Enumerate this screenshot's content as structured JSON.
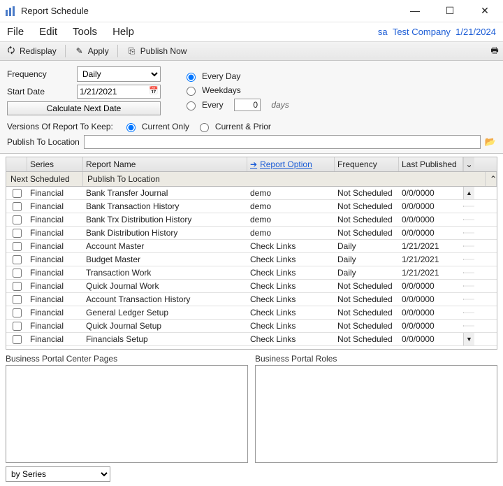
{
  "window": {
    "title": "Report Schedule"
  },
  "menu": {
    "file": "File",
    "edit": "Edit",
    "tools": "Tools",
    "help": "Help",
    "user": "sa",
    "company": "Test Company",
    "date": "1/21/2024"
  },
  "toolbar": {
    "redisplay": "Redisplay",
    "apply": "Apply",
    "publish_now": "Publish Now"
  },
  "form": {
    "frequency_label": "Frequency",
    "frequency_value": "Daily",
    "start_label": "Start Date",
    "start_value": "1/21/2021",
    "calc_button": "Calculate Next Date",
    "every_day": "Every Day",
    "weekdays": "Weekdays",
    "every": "Every",
    "every_n": "0",
    "every_unit": "days"
  },
  "versions": {
    "label": "Versions Of Report To Keep:",
    "current_only": "Current Only",
    "current_prior": "Current & Prior"
  },
  "publish": {
    "label": "Publish To Location",
    "value": ""
  },
  "grid": {
    "hdr": {
      "series": "Series",
      "report_name": "Report Name",
      "report_option": "Report Option",
      "frequency": "Frequency",
      "last_published": "Last Published"
    },
    "sub": {
      "next_scheduled": "Next Scheduled",
      "publish_to": "Publish To Location"
    },
    "rows": [
      {
        "series": "Financial",
        "name": "Bank Transfer Journal",
        "opt": "demo",
        "freq": "Not Scheduled",
        "last": "0/0/0000"
      },
      {
        "series": "Financial",
        "name": "Bank Transaction History",
        "opt": "demo",
        "freq": "Not Scheduled",
        "last": "0/0/0000"
      },
      {
        "series": "Financial",
        "name": "Bank Trx Distribution History",
        "opt": "demo",
        "freq": "Not Scheduled",
        "last": "0/0/0000"
      },
      {
        "series": "Financial",
        "name": "Bank Distribution History",
        "opt": "demo",
        "freq": "Not Scheduled",
        "last": "0/0/0000"
      },
      {
        "series": "Financial",
        "name": "Account Master",
        "opt": "Check Links",
        "freq": "Daily",
        "last": "1/21/2021"
      },
      {
        "series": "Financial",
        "name": "Budget Master",
        "opt": "Check Links",
        "freq": "Daily",
        "last": "1/21/2021"
      },
      {
        "series": "Financial",
        "name": "Transaction Work",
        "opt": "Check Links",
        "freq": "Daily",
        "last": "1/21/2021"
      },
      {
        "series": "Financial",
        "name": "Quick Journal Work",
        "opt": "Check Links",
        "freq": "Not Scheduled",
        "last": "0/0/0000"
      },
      {
        "series": "Financial",
        "name": "Account Transaction History",
        "opt": "Check Links",
        "freq": "Not Scheduled",
        "last": "0/0/0000"
      },
      {
        "series": "Financial",
        "name": "General Ledger Setup",
        "opt": "Check Links",
        "freq": "Not Scheduled",
        "last": "0/0/0000"
      },
      {
        "series": "Financial",
        "name": "Quick Journal Setup",
        "opt": "Check Links",
        "freq": "Not Scheduled",
        "last": "0/0/0000"
      },
      {
        "series": "Financial",
        "name": "Financials Setup",
        "opt": "Check Links",
        "freq": "Not Scheduled",
        "last": "0/0/0000"
      }
    ]
  },
  "boxes": {
    "pages": "Business Portal Center Pages",
    "roles": "Business Portal Roles"
  },
  "footer": {
    "sort": "by Series"
  }
}
